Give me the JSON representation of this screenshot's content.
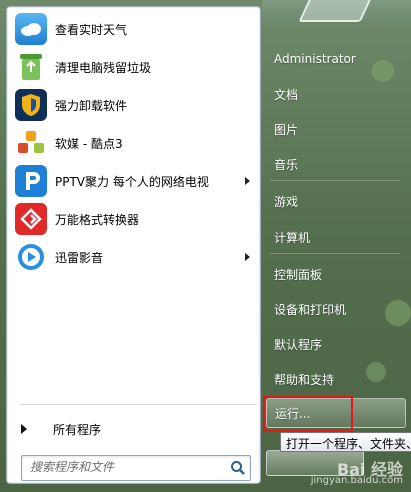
{
  "pinned_programs": [
    {
      "label": "查看实时天气",
      "icon": "weather-icon",
      "color": "#2a8fe0",
      "submenu": false
    },
    {
      "label": "清理电脑残留垃圾",
      "icon": "recycle-bin-icon",
      "color": "#69b64a",
      "submenu": false
    },
    {
      "label": "强力卸载软件",
      "icon": "uninstall-shield-icon",
      "color": "#1b4f9a",
      "submenu": false
    },
    {
      "label": "软媒 - 酷点3",
      "icon": "kudian-cubes-icon",
      "color": "#e5a21a",
      "submenu": false
    },
    {
      "label": "PPTV聚力 每个人的网络电视",
      "icon": "pptv-icon",
      "color": "#1d7fd6",
      "submenu": true
    },
    {
      "label": "万能格式转换器",
      "icon": "format-converter-icon",
      "color": "#e02a2a",
      "submenu": false
    },
    {
      "label": "迅雷影音",
      "icon": "xunlei-player-icon",
      "color": "#1a86d8",
      "submenu": true
    }
  ],
  "all_programs_label": "所有程序",
  "search": {
    "placeholder": "搜索程序和文件"
  },
  "right_items": [
    {
      "label": "Administrator"
    },
    {
      "label": "文档"
    },
    {
      "label": "图片"
    },
    {
      "label": "音乐"
    },
    {
      "label": "游戏"
    },
    {
      "label": "计算机"
    },
    {
      "label": "控制面板"
    },
    {
      "label": "设备和打印机"
    },
    {
      "label": "默认程序"
    },
    {
      "label": "帮助和支持"
    },
    {
      "label": "运行..."
    }
  ],
  "tooltip": "打开一个程序、文件夹、",
  "watermark": {
    "brand": "Bai 经验",
    "url": "jingyan.baidu.com"
  },
  "highlight_color": "#e01818"
}
